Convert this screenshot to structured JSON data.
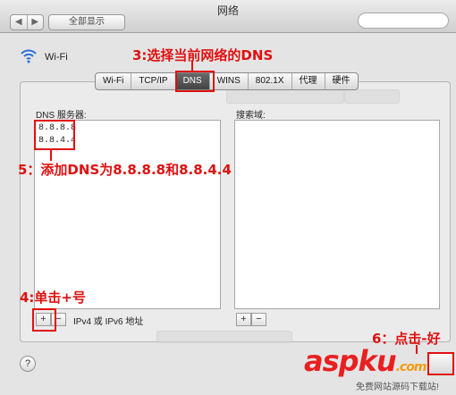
{
  "window": {
    "title": "网络",
    "show_all": "全部显示",
    "back_glyph": "◀",
    "forward_glyph": "▶"
  },
  "service": {
    "name": "Wi-Fi",
    "icon": "wifi-icon"
  },
  "tabs": [
    "Wi-Fi",
    "TCP/IP",
    "DNS",
    "WINS",
    "802.1X",
    "代理",
    "硬件"
  ],
  "active_tab": "DNS",
  "dns": {
    "servers_label": "DNS 服务器:",
    "servers": [
      "8.8.8.8",
      "8.8.4.4"
    ],
    "search_label": "搜索域:",
    "ipv_hint": "IPv4 或 IPv6 地址",
    "add": "+",
    "remove": "−"
  },
  "annotations": {
    "step3": "3:选择当前网络的DNS",
    "step4": "4:单击+号",
    "step5": "5：添加DNS为8.8.8.8和8.8.4.4",
    "step6": "6：点击-好"
  },
  "footer": {
    "help": "?"
  },
  "watermark": {
    "logo": "aspku",
    "suffix": ".com",
    "sub": "免费网站源码下载站!"
  },
  "colors": {
    "annotation": "#e01010",
    "active_tab": "#4a4a4a"
  }
}
